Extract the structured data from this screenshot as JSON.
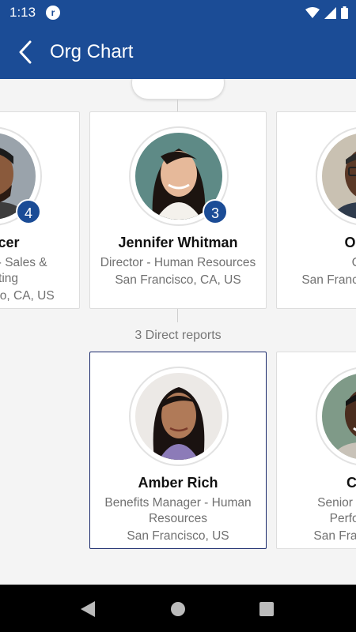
{
  "status": {
    "time": "1:13",
    "app_icon_letter": "r"
  },
  "header": {
    "title": "Org Chart"
  },
  "managers_row": [
    {
      "name": "Spencer",
      "role": "Consultant - Sales & Marketing",
      "location": "San Francisco, CA, US",
      "reports": "4"
    },
    {
      "name": "Jennifer Whitman",
      "role": "Director - Human Resources",
      "location": "San Francisco, CA, US",
      "reports": "3"
    },
    {
      "name": "Oscar",
      "role": "CFO",
      "location": "San Francisco, CA, US",
      "reports": ""
    }
  ],
  "direct_reports_label": "3 Direct reports",
  "reports_row": [
    {
      "name": "Amber Rich",
      "role": "Benefits Manager - Human Resources",
      "location": "San Francisco, US"
    },
    {
      "name": "Craig",
      "role": "Senior Manager - Performance",
      "location": "San Francisco, US"
    }
  ],
  "colors": {
    "primary": "#1b4c96",
    "selected_border": "#1a2a6c"
  }
}
